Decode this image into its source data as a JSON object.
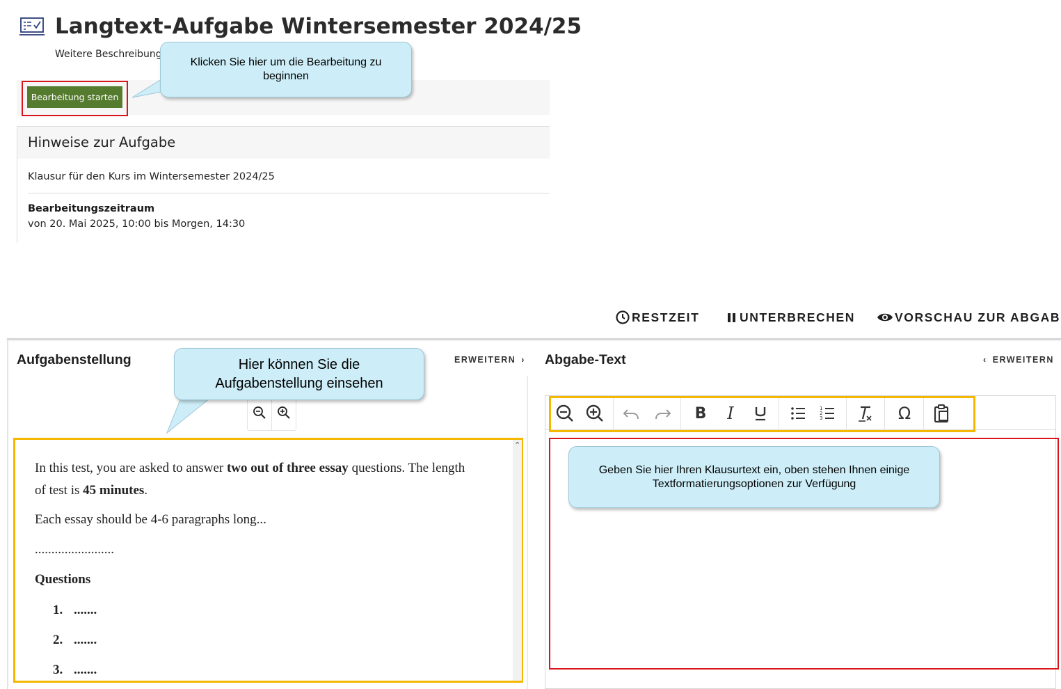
{
  "page": {
    "title": "Langtext-Aufgabe Wintersemester 2024/25",
    "description": "Weitere Beschreibung",
    "start_button": "Bearbeitung starten"
  },
  "callouts": {
    "start": "Klicken Sie hier um die Bearbeitung zu beginnen",
    "task": "Hier können Sie die Aufgabenstellung einsehen",
    "editor": "Geben Sie hier Ihren  Klausurtext ein, oben stehen Ihnen einige Textformatierungsoptionen zur Verfügung"
  },
  "hints": {
    "title": "Hinweise zur Aufgabe",
    "text": "Klausur für den Kurs im Wintersemester 2024/25",
    "period_label": "Bearbeitungszeitraum",
    "period_value": "von 20. Mai 2025, 10:00 bis Morgen, 14:30"
  },
  "top_actions": {
    "time": "RESTZEIT",
    "pause": "UNTERBRECHEN",
    "preview": "VORSCHAU ZUR ABGABE"
  },
  "left_panel": {
    "title": "Aufgabenstellung",
    "expand": "ERWEITERN",
    "document": {
      "p1_start": "In this test, you are asked to answer ",
      "p1_bold": "two out of three essay",
      "p1_end": " questions. The length",
      "p1b_start": "of test is ",
      "p1b_bold": "45 minutes",
      "p1b_end": ".",
      "p2": "Each essay should be 4-6 paragraphs long...",
      "dots": "........................",
      "questions_heading": "Questions",
      "questions": [
        {
          "num": "1.",
          "text": "......."
        },
        {
          "num": "2.",
          "text": "......."
        },
        {
          "num": "3.",
          "text": "......."
        }
      ]
    }
  },
  "right_panel": {
    "title": "Abgabe-Text",
    "expand": "ERWEITERN"
  },
  "icons": {
    "toolbar": [
      "zoom-out-icon",
      "zoom-in-icon",
      "undo-icon",
      "redo-icon",
      "bold-icon",
      "italic-icon",
      "underline-icon",
      "bullet-list-icon",
      "numbered-list-icon",
      "clear-format-icon",
      "special-char-icon",
      "paste-icon"
    ]
  },
  "colors": {
    "start_button": "#557b2e",
    "highlight_red": "#d9141a",
    "highlight_yellow": "#f5b800",
    "callout_bg": "#cdeef8"
  }
}
